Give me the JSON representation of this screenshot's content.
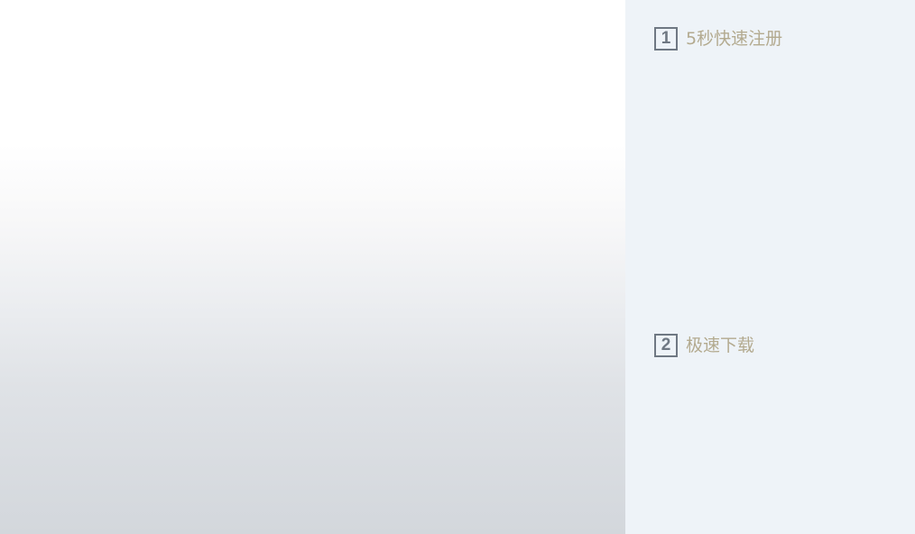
{
  "steps": [
    {
      "number": "1",
      "label": "5秒快速注册"
    },
    {
      "number": "2",
      "label": "极速下载"
    }
  ],
  "colors": {
    "right_panel_bg": "#eef3f8",
    "step_number": "#6f7883",
    "step_label": "#b3aa8f"
  }
}
